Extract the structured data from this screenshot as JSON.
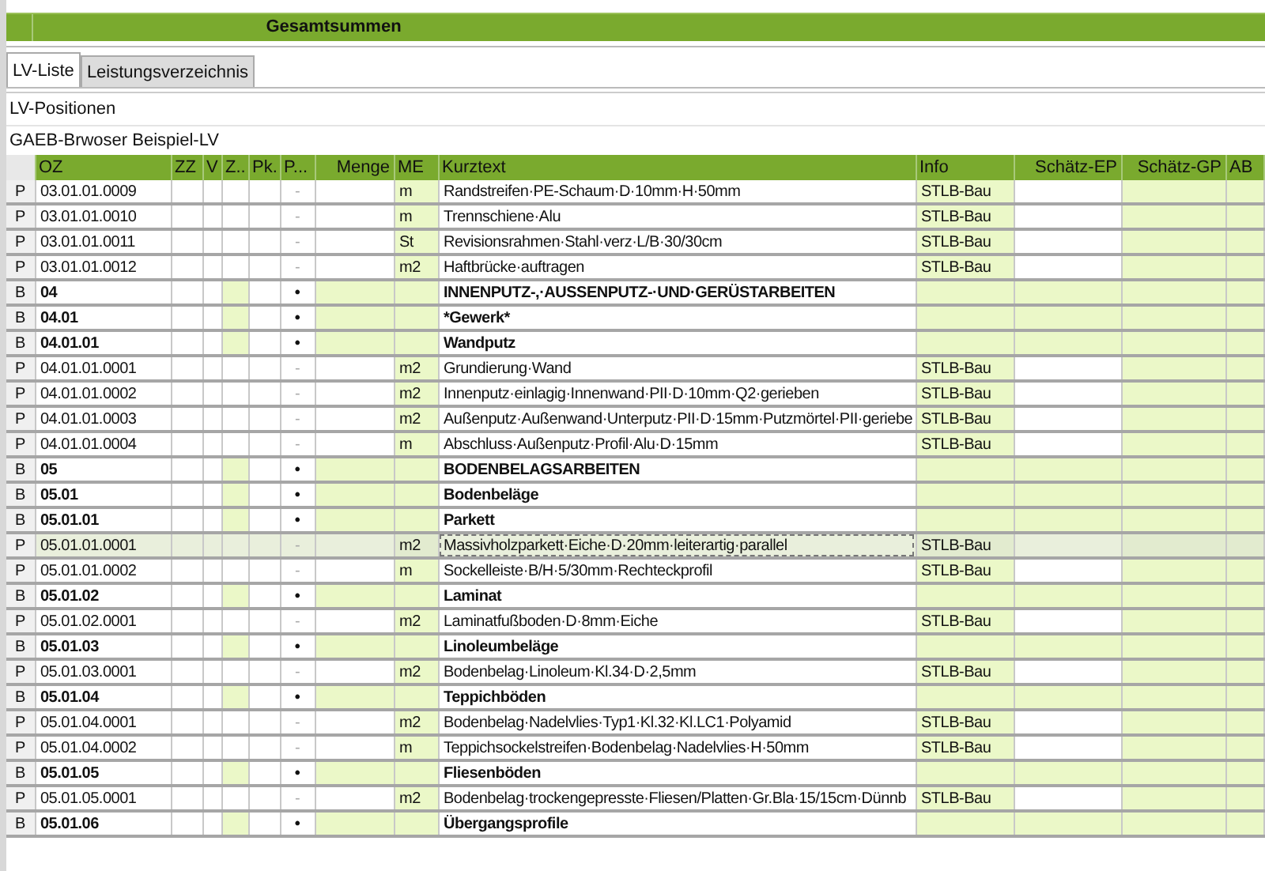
{
  "summary_bar": {
    "title": "Gesamtsummen"
  },
  "tabs": [
    {
      "label": "LV-Liste",
      "selected": true
    },
    {
      "label": "Leistungsverzeichnis",
      "selected": false
    }
  ],
  "section_title": "LV-Positionen",
  "table_title": "GAEB-Brwoser Beispiel-LV",
  "table": {
    "columns": [
      {
        "label": "OZ"
      },
      {
        "label": "ZZ"
      },
      {
        "label": "V"
      },
      {
        "label": "Z.."
      },
      {
        "label": "Pk."
      },
      {
        "label": "P..."
      },
      {
        "label": "Menge"
      },
      {
        "label": "ME"
      },
      {
        "label": "Kurztext"
      },
      {
        "label": "Info"
      },
      {
        "label": "Schätz-EP"
      },
      {
        "label": "Schätz-GP"
      },
      {
        "label": "AB"
      }
    ],
    "rows": [
      {
        "kind": "P",
        "oz": "03.01.01.0009",
        "mark": "-",
        "me": "m",
        "kurztext": "Randstreifen·PE-Schaum·D·10mm·H·50mm",
        "info": "STLB-Bau",
        "selected": false
      },
      {
        "kind": "P",
        "oz": "03.01.01.0010",
        "mark": "-",
        "me": "m",
        "kurztext": "Trennschiene·Alu",
        "info": "STLB-Bau",
        "selected": false
      },
      {
        "kind": "P",
        "oz": "03.01.01.0011",
        "mark": "-",
        "me": "St",
        "kurztext": "Revisionsrahmen·Stahl·verz·L/B·30/30cm",
        "info": "STLB-Bau",
        "selected": false
      },
      {
        "kind": "P",
        "oz": "03.01.01.0012",
        "mark": "-",
        "me": "m2",
        "kurztext": "Haftbrücke·auftragen",
        "info": "STLB-Bau",
        "selected": false
      },
      {
        "kind": "B",
        "oz": "04",
        "mark": "•",
        "kurztext": "INNENPUTZ-,·AUSSENPUTZ-·UND·GERÜSTARBEITEN",
        "selected": false
      },
      {
        "kind": "B",
        "oz": "04.01",
        "mark": "•",
        "kurztext": "*Gewerk*",
        "selected": false
      },
      {
        "kind": "B",
        "oz": "04.01.01",
        "mark": "•",
        "kurztext": "Wandputz",
        "selected": false
      },
      {
        "kind": "P",
        "oz": "04.01.01.0001",
        "mark": "-",
        "me": "m2",
        "kurztext": "Grundierung·Wand",
        "info": "STLB-Bau",
        "selected": false
      },
      {
        "kind": "P",
        "oz": "04.01.01.0002",
        "mark": "-",
        "me": "m2",
        "kurztext": "Innenputz·einlagig·Innenwand·PII·D·10mm·Q2·gerieben",
        "info": "STLB-Bau",
        "selected": false
      },
      {
        "kind": "P",
        "oz": "04.01.01.0003",
        "mark": "-",
        "me": "m2",
        "kurztext": "Außenputz·Außenwand·Unterputz·PII·D·15mm·Putzmörtel·PII·geriebe",
        "info": "STLB-Bau",
        "selected": false
      },
      {
        "kind": "P",
        "oz": "04.01.01.0004",
        "mark": "-",
        "me": "m",
        "kurztext": "Abschluss·Außenputz·Profil·Alu·D·15mm",
        "info": "STLB-Bau",
        "selected": false
      },
      {
        "kind": "B",
        "oz": "05",
        "mark": "•",
        "kurztext": "BODENBELAGSARBEITEN",
        "selected": false
      },
      {
        "kind": "B",
        "oz": "05.01",
        "mark": "•",
        "kurztext": "Bodenbeläge",
        "selected": false
      },
      {
        "kind": "B",
        "oz": "05.01.01",
        "mark": "•",
        "kurztext": "Parkett",
        "selected": false
      },
      {
        "kind": "P",
        "oz": "05.01.01.0001",
        "mark": "-",
        "me": "m2",
        "kurztext": "Massivholzparkett·Eiche·D·20mm·leiterartig·parallel",
        "info": "STLB-Bau",
        "selected": true
      },
      {
        "kind": "P",
        "oz": "05.01.01.0002",
        "mark": "-",
        "me": "m",
        "kurztext": "Sockelleiste·B/H·5/30mm·Rechteckprofil",
        "info": "STLB-Bau",
        "selected": false
      },
      {
        "kind": "B",
        "oz": "05.01.02",
        "mark": "•",
        "kurztext": "Laminat",
        "selected": false
      },
      {
        "kind": "P",
        "oz": "05.01.02.0001",
        "mark": "-",
        "me": "m2",
        "kurztext": "Laminatfußboden·D·8mm·Eiche",
        "info": "STLB-Bau",
        "selected": false
      },
      {
        "kind": "B",
        "oz": "05.01.03",
        "mark": "•",
        "kurztext": "Linoleumbeläge",
        "selected": false
      },
      {
        "kind": "P",
        "oz": "05.01.03.0001",
        "mark": "-",
        "me": "m2",
        "kurztext": "Bodenbelag·Linoleum·Kl.34·D·2,5mm",
        "info": "STLB-Bau",
        "selected": false
      },
      {
        "kind": "B",
        "oz": "05.01.04",
        "mark": "•",
        "kurztext": "Teppichböden",
        "selected": false
      },
      {
        "kind": "P",
        "oz": "05.01.04.0001",
        "mark": "-",
        "me": "m2",
        "kurztext": "Bodenbelag·Nadelvlies·Typ1·Kl.32·Kl.LC1·Polyamid",
        "info": "STLB-Bau",
        "selected": false
      },
      {
        "kind": "P",
        "oz": "05.01.04.0002",
        "mark": "-",
        "me": "m",
        "kurztext": "Teppichsockelstreifen·Bodenbelag·Nadelvlies·H·50mm",
        "info": "STLB-Bau",
        "selected": false
      },
      {
        "kind": "B",
        "oz": "05.01.05",
        "mark": "•",
        "kurztext": "Fliesenböden",
        "selected": false
      },
      {
        "kind": "P",
        "oz": "05.01.05.0001",
        "mark": "-",
        "me": "m2",
        "kurztext": "Bodenbelag·trockengepresste·Fliesen/Platten·Gr.Bla·15/15cm·Dünnb",
        "info": "STLB-Bau",
        "selected": false
      },
      {
        "kind": "B",
        "oz": "05.01.06",
        "mark": "•",
        "kurztext": "Übergangsprofile",
        "selected": false
      }
    ]
  }
}
